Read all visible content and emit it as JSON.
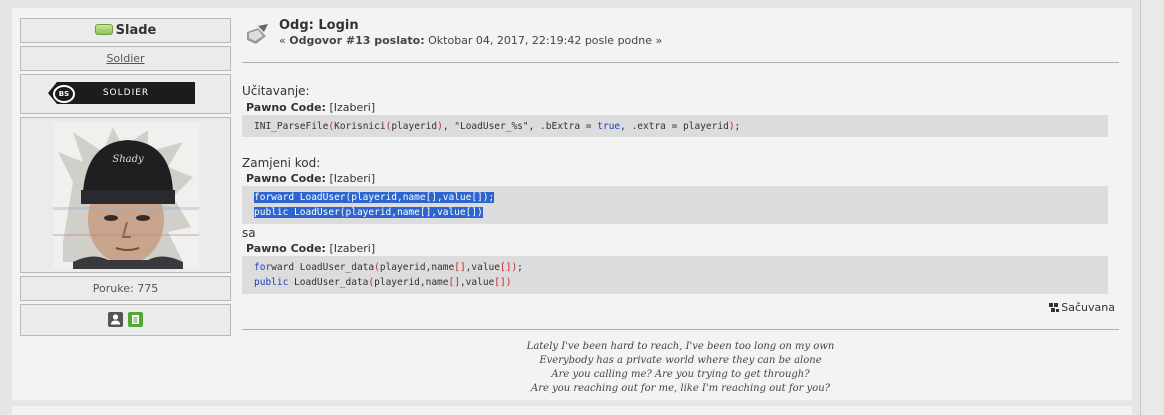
{
  "user": {
    "name": "Slade",
    "rank": "Soldier",
    "badge_text": "SOLDIER",
    "badge_logo": "BS",
    "posts_label": "Poruke: 775"
  },
  "post": {
    "title": "Odg: Login",
    "meta_prefix": "« ",
    "meta_bold": "Odgovor #13 poslato:",
    "meta_date": " Oktobar 04, 2017, 22:19:42 posle podne »",
    "intro_text": "Učitavanje:",
    "code_label": "Pawno Code:",
    "select_label": "[Izaberi]",
    "code1": "INI_ParseFile(Korisnici(playerid), \"LoadUser_%s\", .bExtra = true, .extra = playerid);",
    "replace_text": "Zamjeni kod:",
    "code2_line1": "forward LoadUser(playerid,name[],value[]);",
    "code2_line2": "public LoadUser(playerid,name[],value[])",
    "with_text": "sa",
    "code3_line1": "forward LoadUser_data(playerid,name[],value[]);",
    "code3_line2": "public LoadUser_data(playerid,name[],value[])",
    "saved_label": "Sačuvana"
  },
  "signature": [
    "Lately I've been hard to reach, I've been too long on my own",
    "Everybody has a private world where they can be alone",
    "Are you calling me? Are you trying to get through?",
    "Are you reaching out for me, like I'm reaching out for you?"
  ],
  "icons": {
    "online": "online-status-icon",
    "post_type": "post-icon",
    "profile": "user-profile-icon",
    "message": "document-icon",
    "saved": "saved-icon"
  }
}
